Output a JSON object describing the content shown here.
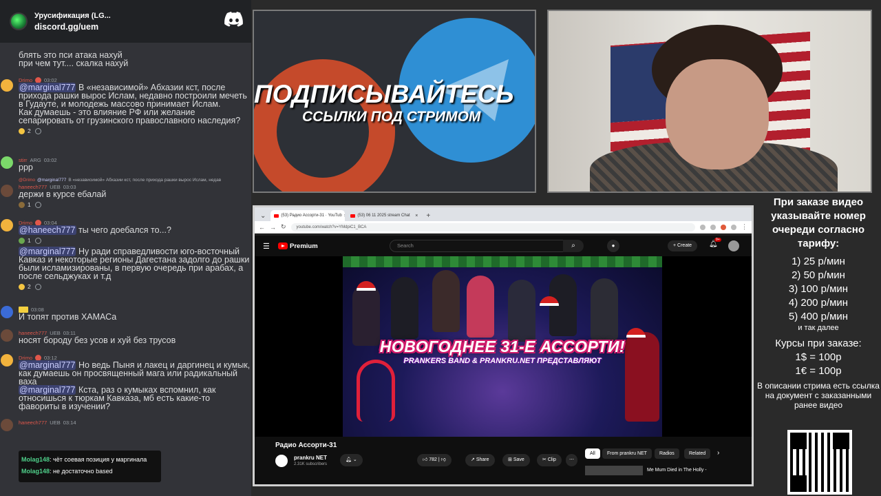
{
  "discord": {
    "server_name": "Урусификация (LG...",
    "invite": "discord.gg/uem"
  },
  "chat": {
    "m0": {
      "line1": "блять это пси атака нахуй",
      "line2": "при чем тут.... скалка нахуй"
    },
    "m1": {
      "user": "Drimo",
      "time": "03:02",
      "mention": "@marginal777",
      "text": " В «независимой» Абхазии кст, после прихода рашки вырос Ислам, недавно построили мечеть в Гудауте, и молодежь массово принимает Ислам.",
      "text2": "Как думаешь - это влияние РФ или желание сепарировать от грузинского православного наследия?",
      "react_count": "2"
    },
    "m2": {
      "user": "stirr",
      "tag": "ARG",
      "time": "03:02",
      "text": "ррр"
    },
    "reply": {
      "user": "@Drimo",
      "mention": "@marginal777",
      "text": "В «независимой» Абхазии кст, после прихода рашки вырос Ислам, недав"
    },
    "m3": {
      "user": "haneech777",
      "tag": "UEB",
      "time": "03:03",
      "text": "держи в курсе ебалай",
      "react_count": "1"
    },
    "m4": {
      "user": "Drimo",
      "time": "03:04",
      "mention": "@haneech777",
      "text": " ты чего доебался то...?",
      "react_count": "1",
      "mention2": "@marginal777",
      "text2": " Ну ради справедливости юго-восточный Кавказ и некоторые регионы Дагестана задолго до рашки были исламизированы, в первую очередь при арабах, а после сельджуках и т.д",
      "react_count2": "2"
    },
    "m5": {
      "time": "03:08",
      "text": "И топят против ХАМАСа"
    },
    "m6": {
      "user": "haneech777",
      "tag": "UEB",
      "time": "03:11",
      "text": "носят бороду без усов и хуй без трусов"
    },
    "m7": {
      "user": "Drimo",
      "time": "03:12",
      "mention": "@marginal777",
      "text": " Но ведь Пыня и лакец и даргинец и кумык, как думаешь он просвященный мага или радикальный ваха",
      "mention2": "@marginal777",
      "text2": " Кста, раз о кумыках вспомнил, как относишься к тюркам Кавказа, мб есть какие-то фавориты в изучении?"
    },
    "m8": {
      "user": "haneech777",
      "tag": "UEB",
      "time": "03:14"
    },
    "popup": [
      {
        "user": "Molag148",
        "text": ": чёт соевая позиция у маргинала"
      },
      {
        "user": "Molag148",
        "text": ": не достаточно based"
      }
    ]
  },
  "banner": {
    "line1": "ПОДПИСЫВАЙТЕСЬ",
    "line2": "ССЫЛКИ ПОД СТРИМОМ"
  },
  "info": {
    "heading": "При заказе видео указывайте номер очереди согласно тарифу:",
    "tariffs": [
      "1) 25 р/мин",
      "2) 50 р/мин",
      "3) 100 р/мин",
      "4) 200 р/мин",
      "5) 400 р/мин"
    ],
    "etc": "и так далее",
    "rates_title": "Курсы при заказе:",
    "rate1": "1$ = 100р",
    "rate2": "1€ = 100р",
    "desc": "В описании стрима есть ссылка на документ с заказанными ранее видео"
  },
  "browser": {
    "tab1": "(53) Радио Ассорти-31 · YouTub",
    "tab2": "(53) 06 11 2025 stream Chat",
    "url": "youtube.com/watch?v=YMdpiC1_BCA"
  },
  "youtube": {
    "logo": "Premium",
    "search_placeholder": "Search",
    "create": "Create",
    "notif_badge": "9+",
    "thumb_title": "НОВОГОДНЕЕ 31-Е АССОРТИ!",
    "thumb_subtitle": "PRANKERS BAND & PRANKRU.NET ПРЕДСТАВЛЯЮТ",
    "video_title": "Радио Ассорти-31",
    "channel": "prankru NET",
    "subscribers": "2.31K subscribers",
    "likes": "782",
    "share": "Share",
    "save": "Save",
    "clip": "Clip",
    "chips": [
      "All",
      "From prankru NET",
      "Radios",
      "Related"
    ],
    "suggestion": "Me Mum Died in The Holly -"
  }
}
